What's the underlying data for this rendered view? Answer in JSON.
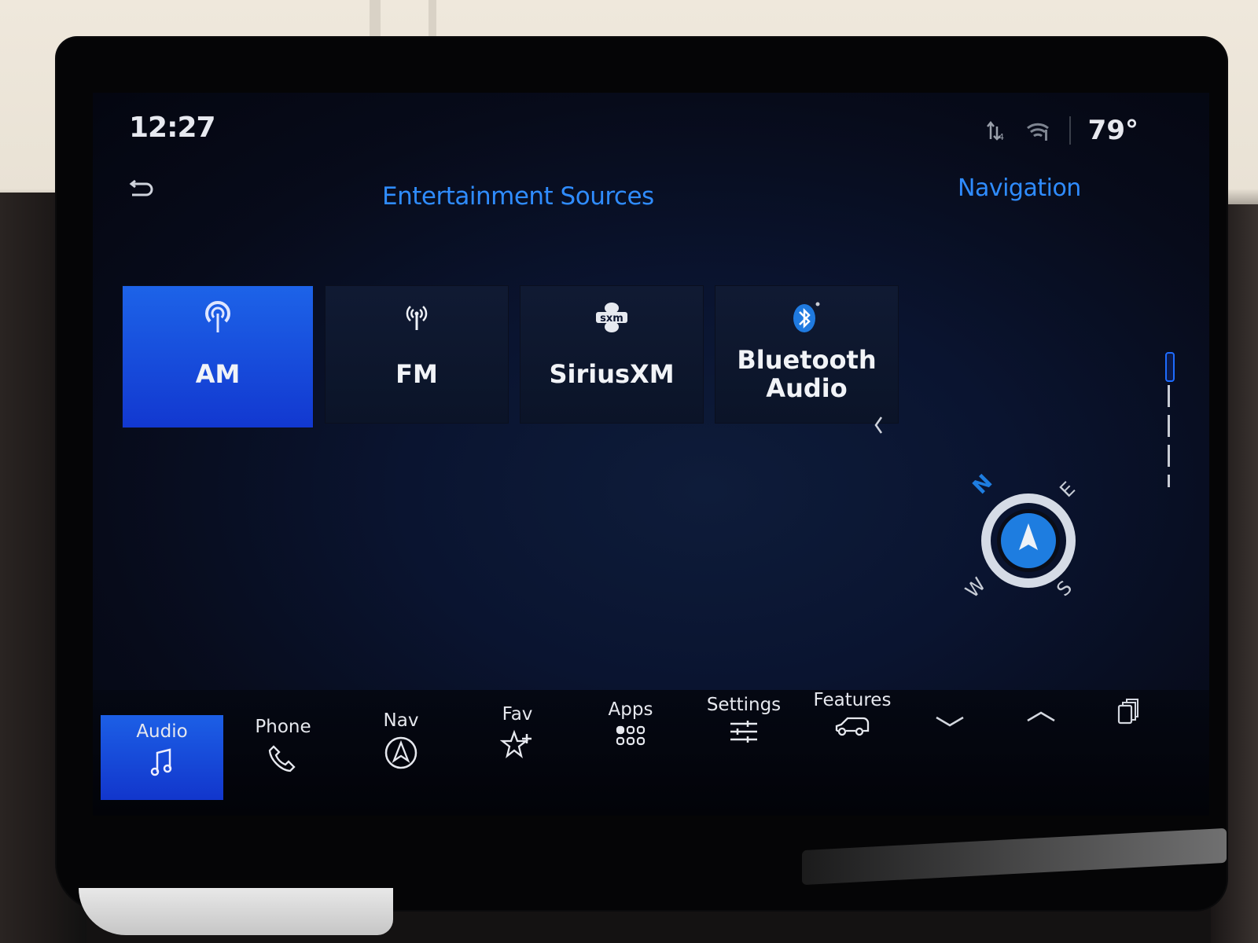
{
  "status_bar": {
    "time": "12:27",
    "temperature": "79°",
    "icons": [
      "data-transfer-icon",
      "wifi-signal-icon"
    ]
  },
  "header": {
    "back_icon": "back-arrow-icon",
    "title": "Entertainment Sources",
    "right_panel_title": "Navigation"
  },
  "sources": [
    {
      "label": "AM",
      "icon": "am-antenna-icon",
      "active": true
    },
    {
      "label": "FM",
      "icon": "fm-antenna-icon",
      "active": false
    },
    {
      "label": "SiriusXM",
      "icon": "siriusxm-icon",
      "icon_text": "sxm",
      "active": false
    },
    {
      "label_line1": "Bluetooth",
      "label_line2": "Audio",
      "icon": "bluetooth-icon",
      "active": false
    }
  ],
  "compass": {
    "north": "N",
    "east": "E",
    "south": "S",
    "west": "W",
    "accent_color": "#1e7de0"
  },
  "bottom_nav": [
    {
      "label": "Audio",
      "icon": "music-note-icon",
      "active": true
    },
    {
      "label": "Phone",
      "icon": "phone-icon",
      "active": false
    },
    {
      "label": "Nav",
      "icon": "navigation-arrow-icon",
      "active": false
    },
    {
      "label": "Fav",
      "icon": "star-plus-icon",
      "active": false
    },
    {
      "label": "Apps",
      "icon": "apps-grid-icon",
      "active": false
    },
    {
      "label": "Settings",
      "icon": "sliders-icon",
      "active": false
    },
    {
      "label": "Features",
      "icon": "vehicle-icon",
      "active": false
    }
  ],
  "bottom_controls": [
    "chevron-down-icon",
    "chevron-up-icon",
    "stacked-cards-icon"
  ],
  "colors": {
    "accent": "#2f8cff",
    "active_tile": "#1d55e4",
    "screen_bg": "#0a1430"
  }
}
